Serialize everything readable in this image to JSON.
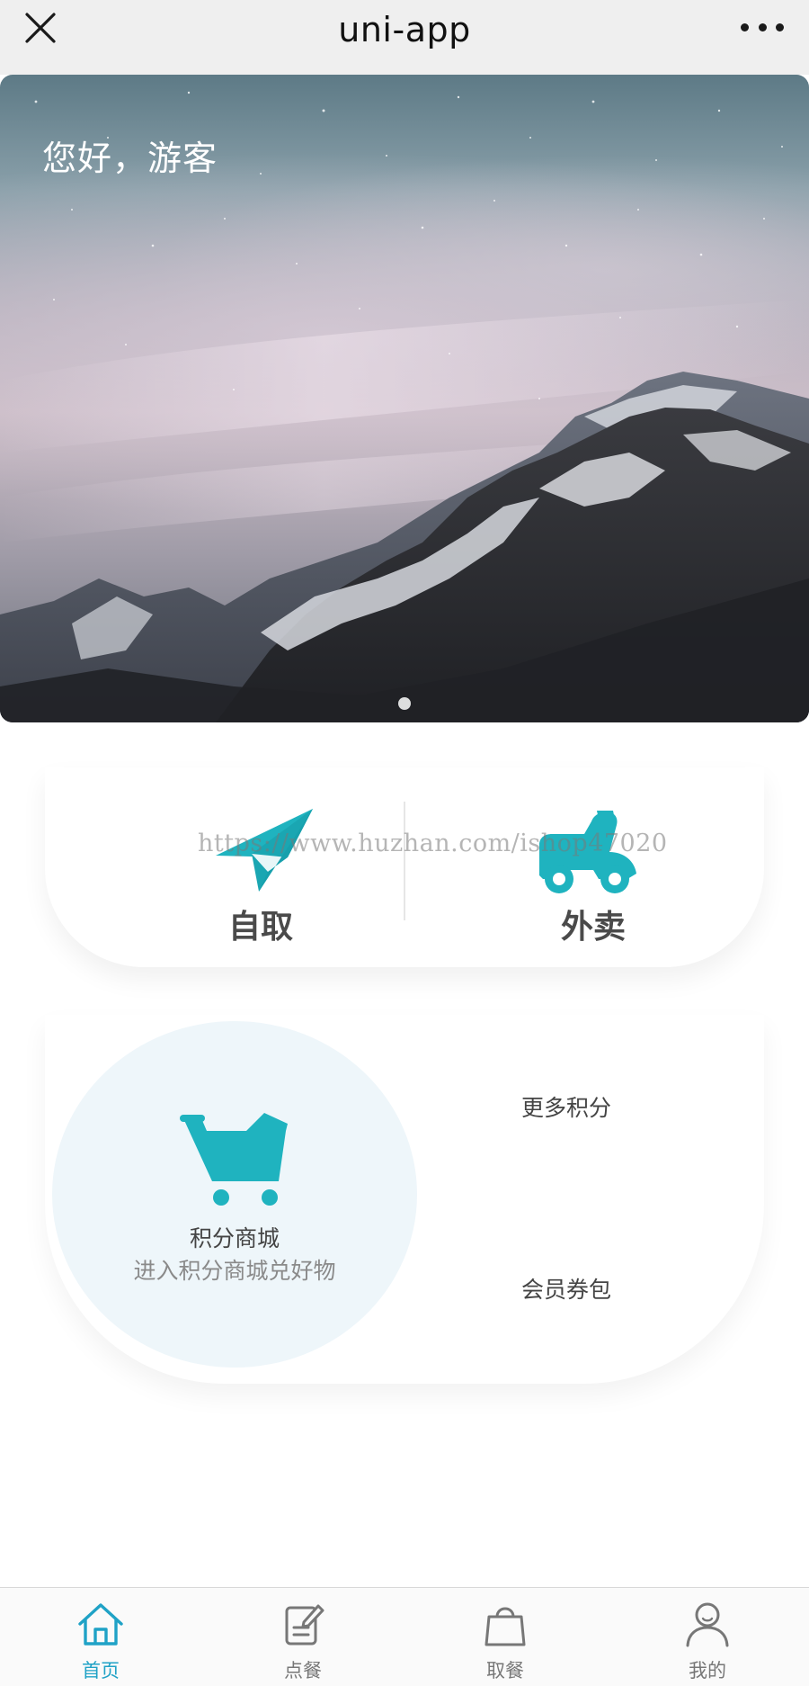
{
  "navbar": {
    "title": "uni-app",
    "close_icon": "close-icon",
    "more_icon": "more-dots-icon"
  },
  "hero": {
    "greeting": "您好，游客",
    "carousel_dots": 1,
    "active_dot": 1
  },
  "order_modes": {
    "pickup_label": "自取",
    "pickup_icon": "paper-plane-icon",
    "delivery_label": "外卖",
    "delivery_icon": "scooter-icon"
  },
  "watermark": "https://www.huzhan.com/ishop47020",
  "points": {
    "mall_title": "积分商城",
    "mall_subtitle": "进入积分商城兑好物",
    "mall_icon": "shopping-cart-icon",
    "more_points": "更多积分",
    "member_coupons": "会员券包"
  },
  "tabbar": {
    "items": [
      {
        "label": "首页",
        "icon": "home-icon",
        "active": true
      },
      {
        "label": "点餐",
        "icon": "edit-note-icon",
        "active": false
      },
      {
        "label": "取餐",
        "icon": "shopping-bag-icon",
        "active": false
      },
      {
        "label": "我的",
        "icon": "user-icon",
        "active": false
      }
    ]
  },
  "colors": {
    "accent": "#1fb3bf",
    "tab_active": "#1fa2c6",
    "navbar_bg": "#efefef",
    "mall_circle_bg": "#eef6fa"
  }
}
